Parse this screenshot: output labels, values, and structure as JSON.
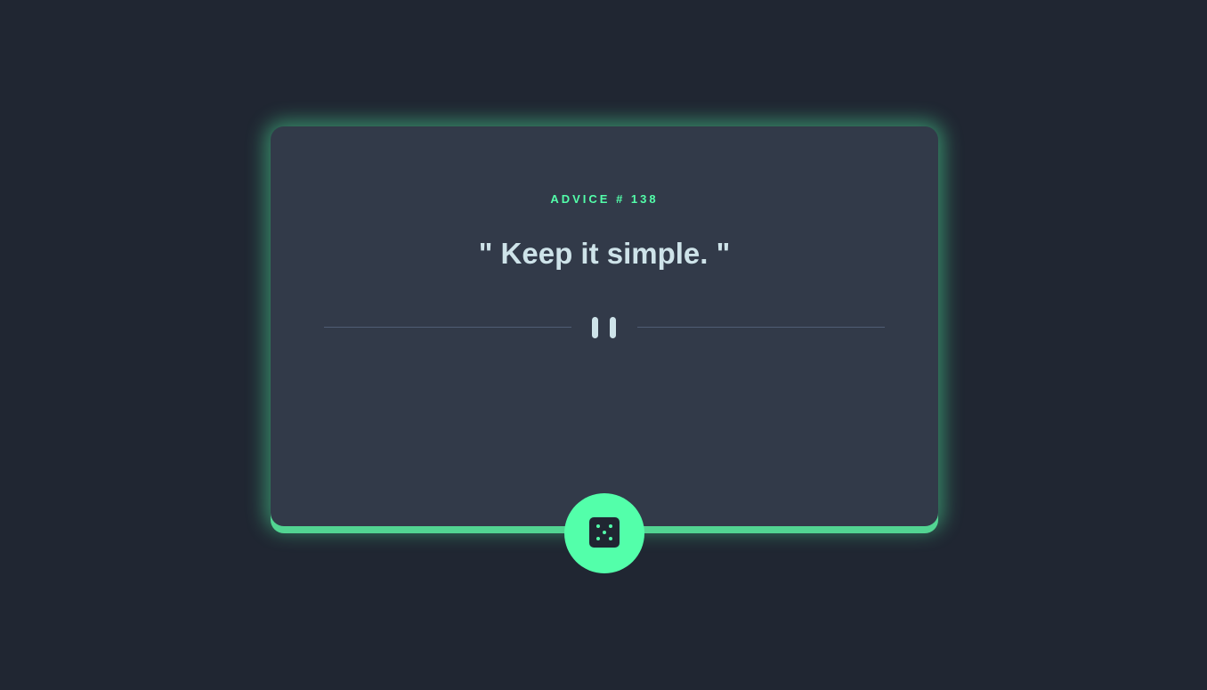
{
  "advice": {
    "id_label": "ADVICE # 138",
    "text": "\" Keep it simple. \""
  },
  "divider": {
    "icon": "pause-icon"
  },
  "button": {
    "icon": "dice-icon"
  },
  "colors": {
    "background": "#202632",
    "card": "#323a49",
    "accent": "#53ffaa",
    "text": "#cee3e9",
    "divider": "#4f5d74"
  }
}
